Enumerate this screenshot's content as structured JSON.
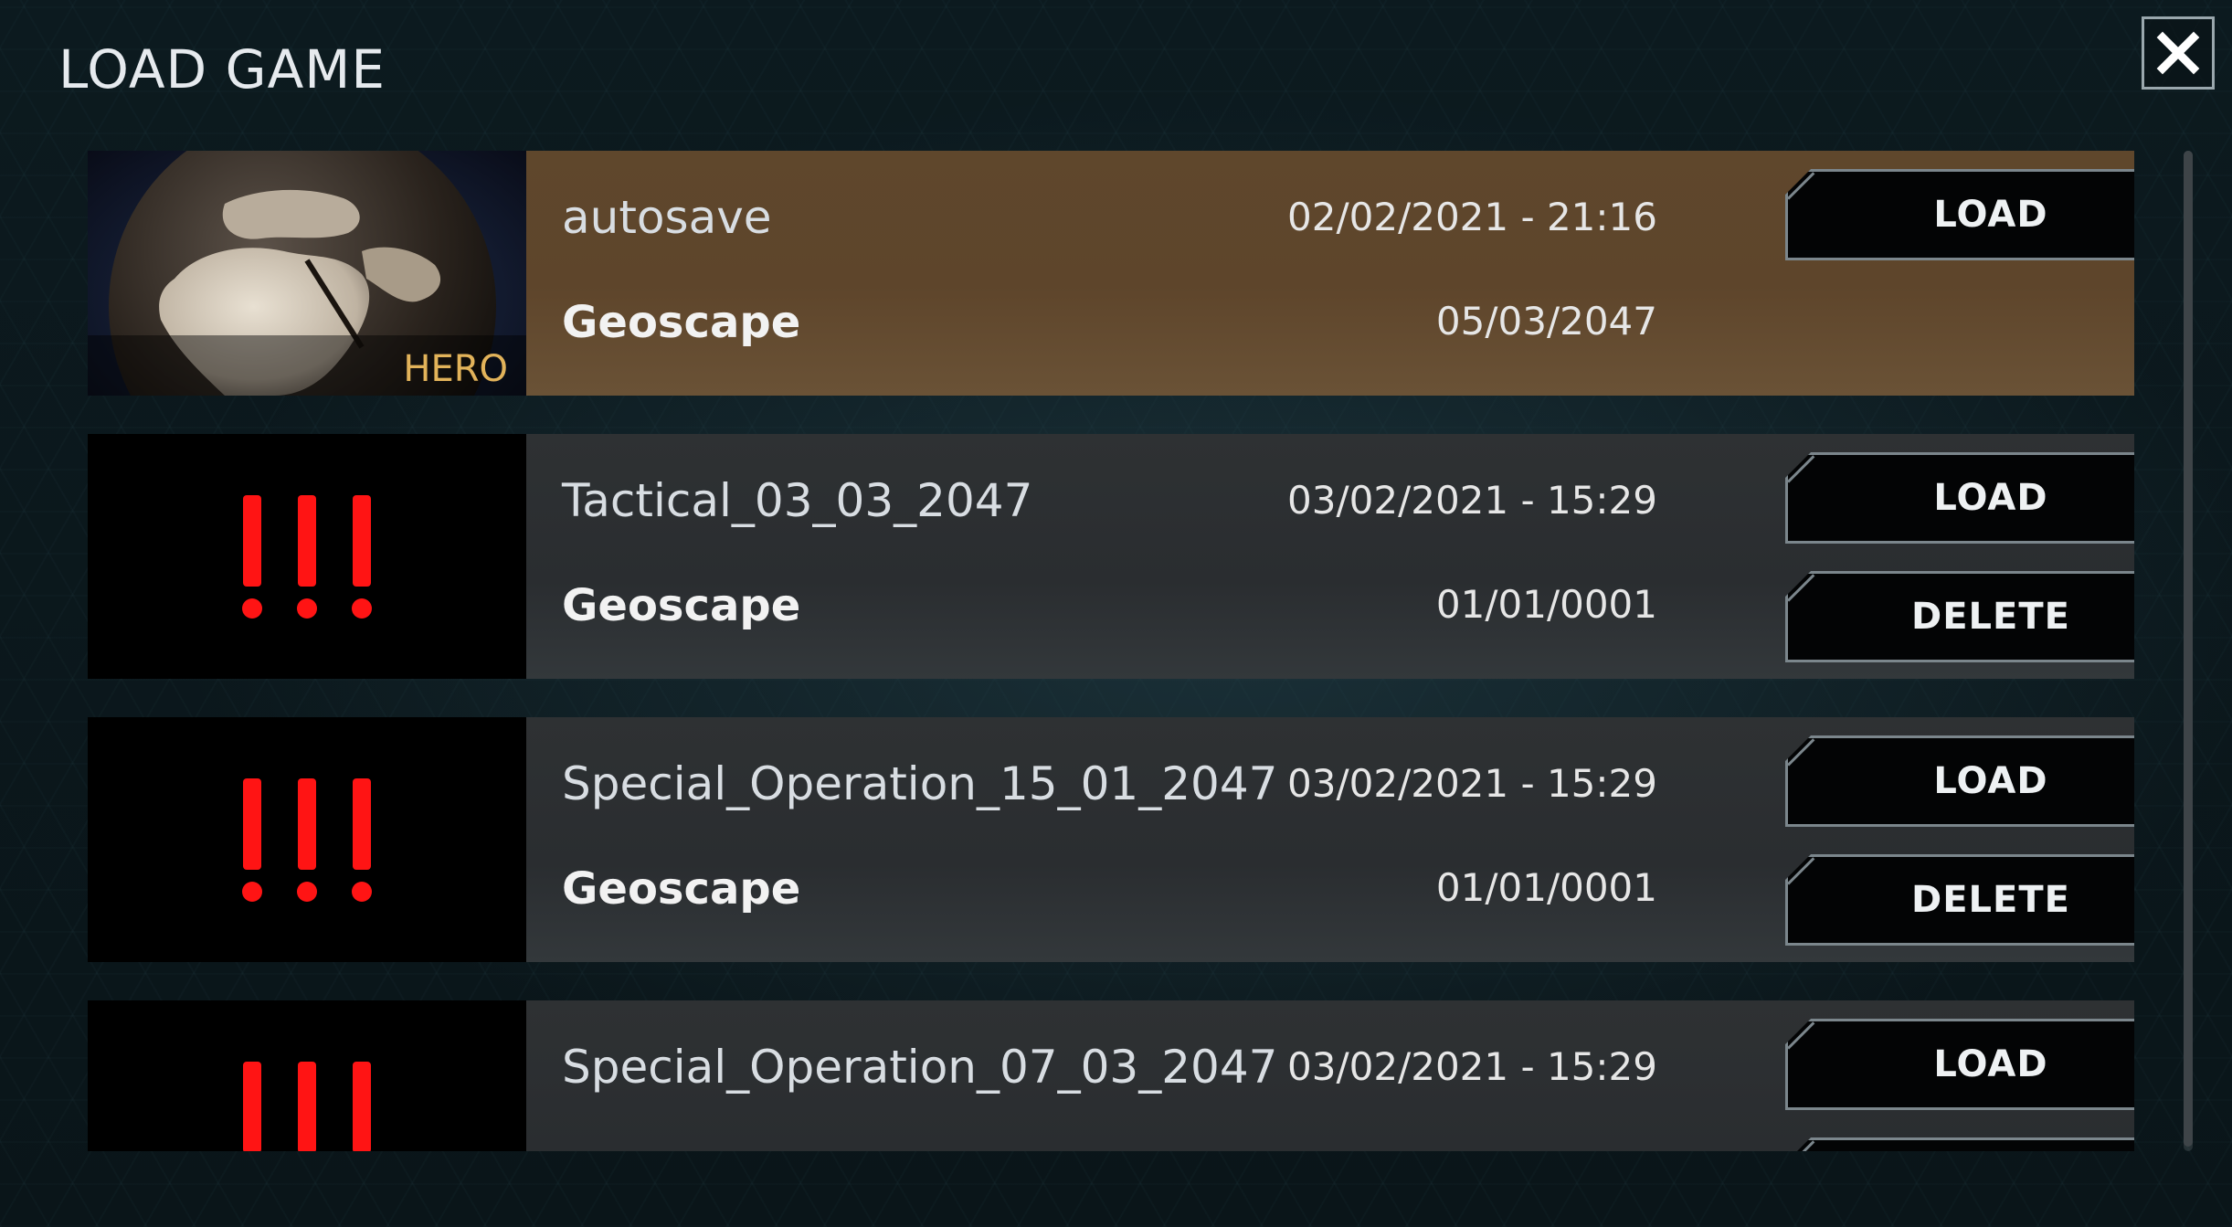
{
  "window": {
    "title": "LOAD GAME",
    "close_icon": "close-icon"
  },
  "saves": [
    {
      "name": "autosave",
      "real_date": "02/02/2021 - 21:16",
      "mode": "Geoscape",
      "game_date": "05/03/2047",
      "thumbnail": "globe",
      "thumb_label": "HERO",
      "load_label": "LOAD",
      "delete_label": "",
      "selected": true
    },
    {
      "name": "Tactical_03_03_2047",
      "real_date": "03/02/2021 - 15:29",
      "mode": "Geoscape",
      "game_date": "01/01/0001",
      "thumbnail": "warning",
      "load_label": "LOAD",
      "delete_label": "DELETE"
    },
    {
      "name": "Special_Operation_15_01_2047",
      "real_date": "03/02/2021 - 15:29",
      "mode": "Geoscape",
      "game_date": "01/01/0001",
      "thumbnail": "warning",
      "load_label": "LOAD",
      "delete_label": "DELETE"
    },
    {
      "name": "Special_Operation_07_03_2047",
      "real_date": "03/02/2021 - 15:29",
      "mode": "",
      "game_date": "",
      "thumbnail": "warning",
      "load_label": "LOAD",
      "delete_label": ""
    }
  ],
  "colors": {
    "selected_row": "#5f472c",
    "row": "#2e3133",
    "warning": "#ff1414",
    "hero_label": "#e2b35a"
  }
}
